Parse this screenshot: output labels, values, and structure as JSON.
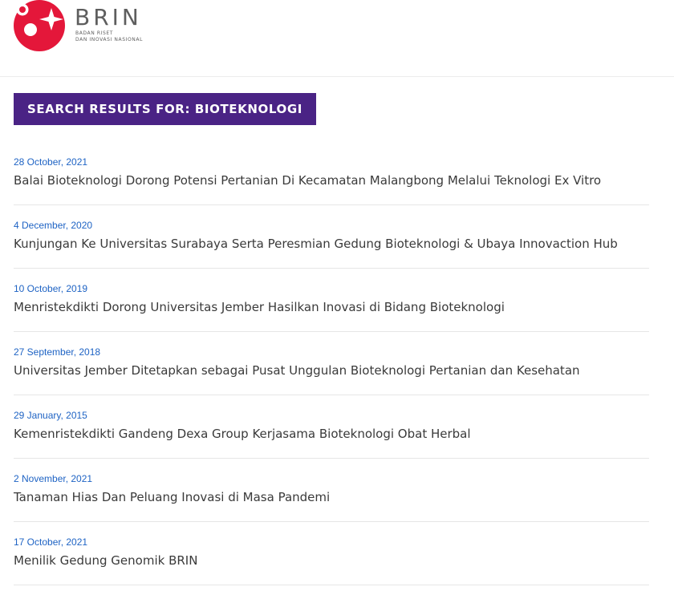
{
  "brand": {
    "name": "BRIN",
    "tagline": "BADAN RISET\nDAN INOVASI NASIONAL",
    "logo_color": "#e4173a",
    "text_color": "#5e5e5e"
  },
  "search": {
    "banner_label": "SEARCH RESULTS FOR: BIOTEKNOLOGI",
    "banner_color": "#4a2385"
  },
  "results": [
    {
      "date": "28 October, 2021",
      "title": "Balai Bioteknologi Dorong Potensi Pertanian Di Kecamatan Malangbong Melalui Teknologi Ex Vitro"
    },
    {
      "date": "4 December, 2020",
      "title": "Kunjungan Ke Universitas Surabaya Serta Peresmian Gedung Bioteknologi & Ubaya Innovaction Hub"
    },
    {
      "date": "10 October, 2019",
      "title": "Menristekdikti Dorong Universitas Jember Hasilkan Inovasi di Bidang Bioteknologi"
    },
    {
      "date": "27 September, 2018",
      "title": "Universitas Jember Ditetapkan sebagai Pusat Unggulan Bioteknologi Pertanian dan Kesehatan"
    },
    {
      "date": "29 January, 2015",
      "title": "Kemenristekdikti Gandeng Dexa Group Kerjasama Bioteknologi Obat Herbal"
    },
    {
      "date": "2 November, 2021",
      "title": "Tanaman Hias Dan Peluang Inovasi di Masa Pandemi"
    },
    {
      "date": "17 October, 2021",
      "title": "Menilik Gedung Genomik BRIN"
    }
  ]
}
